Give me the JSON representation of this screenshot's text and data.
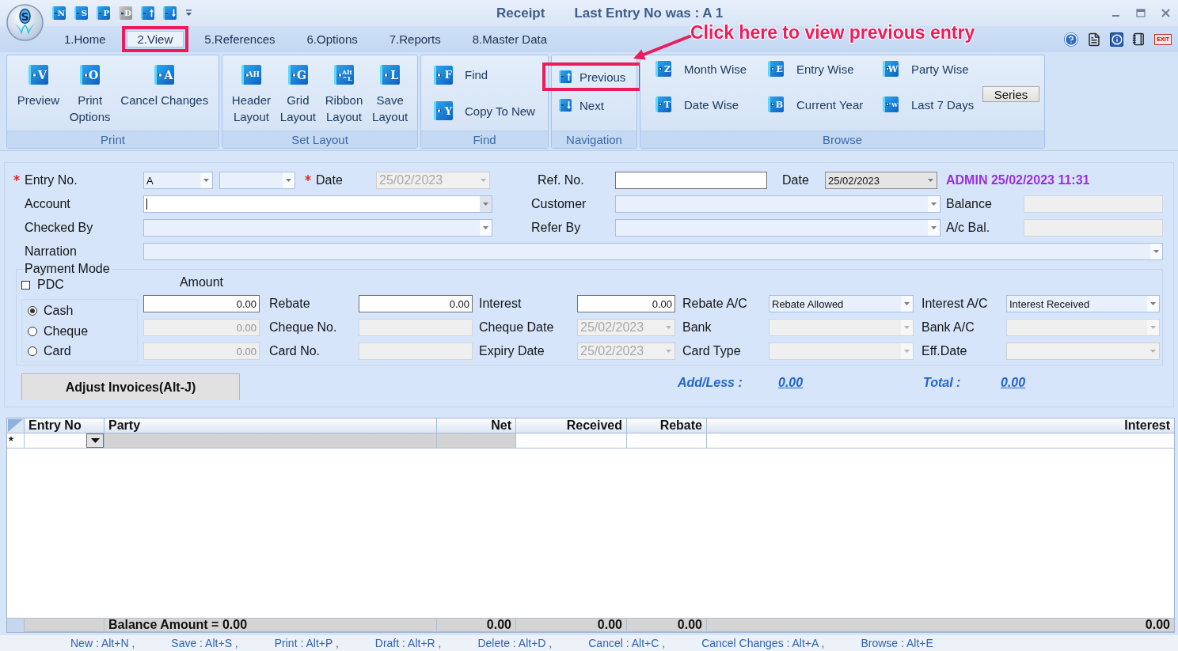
{
  "window": {
    "title": "Receipt",
    "status": "Last Entry No was : A 1"
  },
  "logo": {
    "letter": "S"
  },
  "quick_access": [
    {
      "kind": "letter",
      "key": "N",
      "disabled": false
    },
    {
      "kind": "letter",
      "key": "S",
      "disabled": false
    },
    {
      "kind": "letter",
      "key": "P",
      "disabled": false
    },
    {
      "kind": "letter",
      "key": "D",
      "disabled": true
    },
    {
      "kind": "up",
      "disabled": false
    },
    {
      "kind": "down",
      "disabled": false
    }
  ],
  "tabs": [
    {
      "label": "1.Home",
      "selected": false,
      "highlighted": false
    },
    {
      "label": "2.View",
      "selected": true,
      "highlighted": true
    },
    {
      "label": "5.References",
      "selected": false,
      "highlighted": false
    },
    {
      "label": "6.Options",
      "selected": false,
      "highlighted": false
    },
    {
      "label": "7.Reports",
      "selected": false,
      "highlighted": false
    },
    {
      "label": "8.Master Data",
      "selected": false,
      "highlighted": false
    }
  ],
  "toolbar_icons": [
    {
      "kind": "help"
    },
    {
      "kind": "document"
    },
    {
      "kind": "info"
    },
    {
      "kind": "notebook"
    },
    {
      "kind": "exit",
      "label": "EXIT"
    }
  ],
  "callout": {
    "text": "Click here to view previous entry"
  },
  "ribbon": [
    {
      "title": "Print",
      "kind": "large",
      "items": [
        {
          "label": "Preview",
          "key": "V"
        },
        {
          "label": "Print\nOptions",
          "key": "O"
        },
        {
          "label": "Cancel Changes",
          "key": "A"
        }
      ]
    },
    {
      "title": "Set Layout",
      "kind": "large",
      "items": [
        {
          "label": "Header\nLayout",
          "key": "AH"
        },
        {
          "label": "Grid\nLayout",
          "key": "G"
        },
        {
          "label": "Ribbon\nLayout",
          "key": "Alt ^L"
        },
        {
          "label": "Save\nLayout",
          "key": "L"
        }
      ]
    },
    {
      "title": "Find",
      "kind": "list",
      "items": [
        {
          "label": "Find",
          "key": "F"
        },
        {
          "label": "Copy To New",
          "key": "Y"
        }
      ]
    },
    {
      "title": "Navigation",
      "kind": "nav",
      "items": [
        {
          "label": "Previous",
          "kind": "up",
          "highlighted": true
        },
        {
          "label": "Next",
          "kind": "down",
          "highlighted": false
        }
      ]
    },
    {
      "title": "Browse",
      "kind": "grid",
      "items": [
        {
          "label": "Month Wise",
          "key": "Z"
        },
        {
          "label": "Entry Wise",
          "key": "E"
        },
        {
          "label": "Party Wise",
          "key": "W"
        },
        {
          "label": "Date Wise",
          "key": "T"
        },
        {
          "label": "Current Year",
          "key": "B"
        },
        {
          "label": "Last 7 Days",
          "key": "^W"
        }
      ],
      "button": "Series"
    }
  ],
  "form": {
    "entry_no": {
      "label": "Entry No.",
      "required": true,
      "series": {
        "kind": "combo",
        "value": "A",
        "disabled": false
      },
      "number": {
        "kind": "combo",
        "disabled": false
      }
    },
    "date": {
      "label": "Date",
      "required": true,
      "field": {
        "kind": "date",
        "value": "25/02/2023",
        "disabled": true
      }
    },
    "ref_no": {
      "label": "Ref. No.",
      "field": {
        "kind": "text",
        "disabled": false
      }
    },
    "ref_date": {
      "label": "Date",
      "field": {
        "kind": "date",
        "value": "25/02/2023",
        "disabled": false
      }
    },
    "audit": "ADMIN 25/02/2023 11:31",
    "account": {
      "label": "Account",
      "field": {
        "kind": "combo",
        "disabled": false,
        "focused": true
      }
    },
    "customer": {
      "label": "Customer",
      "field": {
        "kind": "combo",
        "disabled": false
      }
    },
    "balance": {
      "label": "Balance",
      "field": {
        "kind": "text",
        "disabled": true
      }
    },
    "checked_by": {
      "label": "Checked By",
      "field": {
        "kind": "combo",
        "disabled": false
      }
    },
    "refer_by": {
      "label": "Refer By",
      "field": {
        "kind": "combo",
        "disabled": false
      }
    },
    "ac_bal": {
      "label": "A/c Bal.",
      "field": {
        "kind": "text",
        "disabled": true
      }
    },
    "narration": {
      "label": "Narration",
      "field": {
        "kind": "combo",
        "disabled": false
      }
    }
  },
  "payment": {
    "title": "Payment Mode",
    "pdc": {
      "label": "PDC",
      "checked": false
    },
    "modes": [
      {
        "label": "Cash",
        "selected": true
      },
      {
        "label": "Cheque",
        "selected": false
      },
      {
        "label": "Card",
        "selected": false
      }
    ],
    "amount_label": "Amount",
    "rows": [
      {
        "amount": {
          "kind": "number",
          "value": "0.00",
          "disabled": false
        },
        "cells": [
          {
            "label": "Rebate",
            "field": {
              "kind": "number",
              "value": "0.00",
              "disabled": false
            }
          },
          {
            "label": "Interest",
            "field": {
              "kind": "number",
              "value": "0.00",
              "disabled": false
            }
          },
          {
            "label": "Rebate A/C",
            "field": {
              "kind": "combo",
              "value": "Rebate Allowed",
              "disabled": false
            }
          },
          {
            "label": "Interest A/C",
            "field": {
              "kind": "combo",
              "value": "Interest Received",
              "disabled": false
            }
          }
        ]
      },
      {
        "amount": {
          "kind": "number",
          "value": "0.00",
          "disabled": true
        },
        "cells": [
          {
            "label": "Cheque No.",
            "field": {
              "kind": "text",
              "disabled": true
            }
          },
          {
            "label": "Cheque Date",
            "field": {
              "kind": "date",
              "value": "25/02/2023",
              "disabled": true
            }
          },
          {
            "label": "Bank",
            "field": {
              "kind": "combo",
              "disabled": true
            }
          },
          {
            "label": "Bank A/C",
            "field": {
              "kind": "combo",
              "disabled": true
            }
          }
        ]
      },
      {
        "amount": {
          "kind": "number",
          "value": "0.00",
          "disabled": true
        },
        "cells": [
          {
            "label": "Card No.",
            "field": {
              "kind": "text",
              "disabled": true
            }
          },
          {
            "label": "Expiry Date",
            "field": {
              "kind": "date",
              "value": "25/02/2023",
              "disabled": true
            }
          },
          {
            "label": "Card Type",
            "field": {
              "kind": "combo",
              "disabled": true
            }
          },
          {
            "label": "Eff.Date",
            "field": {
              "kind": "date",
              "disabled": true
            }
          }
        ]
      }
    ]
  },
  "adjust_button": "Adjust Invoices(Alt-J)",
  "totals": [
    {
      "label": "Add/Less :",
      "value": "0.00"
    },
    {
      "label": "Total :",
      "value": "0.00"
    }
  ],
  "grid": {
    "columns": [
      {
        "label": "Entry No",
        "kind": "combo",
        "readonly": false
      },
      {
        "label": "Party",
        "kind": "text",
        "readonly": true
      },
      {
        "label": "Net",
        "kind": "number",
        "readonly": true
      },
      {
        "label": "Received",
        "kind": "number",
        "readonly": false
      },
      {
        "label": "Rebate",
        "kind": "number",
        "readonly": false
      },
      {
        "label": "Interest",
        "kind": "number",
        "readonly": false
      }
    ],
    "new_row_marker": "*",
    "footer": {
      "caption": "Balance Amount = 0.00",
      "totals": [
        "0.00",
        "0.00",
        "0.00",
        "0.00"
      ]
    }
  },
  "shortcuts": [
    "New : Alt+N ,",
    "Save : Alt+S ,",
    "Print : Alt+P ,",
    "Draft : Alt+R ,",
    "Delete : Alt+D ,",
    "Cancel : Alt+C ,",
    "Cancel Changes : Alt+A ,",
    "Browse : Alt+E"
  ]
}
